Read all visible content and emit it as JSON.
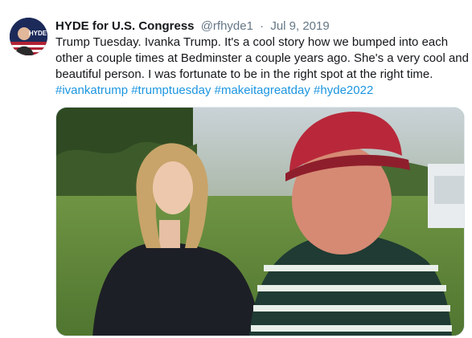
{
  "tweet": {
    "display_name": "HYDE for U.S. Congress",
    "handle": "@rfhyde1",
    "separator": "·",
    "date": "Jul 9, 2019",
    "text_lines": [
      "Trump Tuesday. Ivanka Trump. It's a cool story how we bumped into each",
      "other a couple times at Bedminster a couple years ago. She's a very cool and",
      "beautiful person. I was fortunate to be in the right spot at the right time."
    ],
    "hashtags": [
      "#ivankatrump",
      "#trumptuesday",
      "#makeitagreatday",
      "#hyde2022"
    ],
    "avatar_text": "HYDE",
    "colors": {
      "text": "#14171a",
      "secondary": "#657786",
      "link": "#1b95e0",
      "border": "#e1e8ed"
    }
  }
}
